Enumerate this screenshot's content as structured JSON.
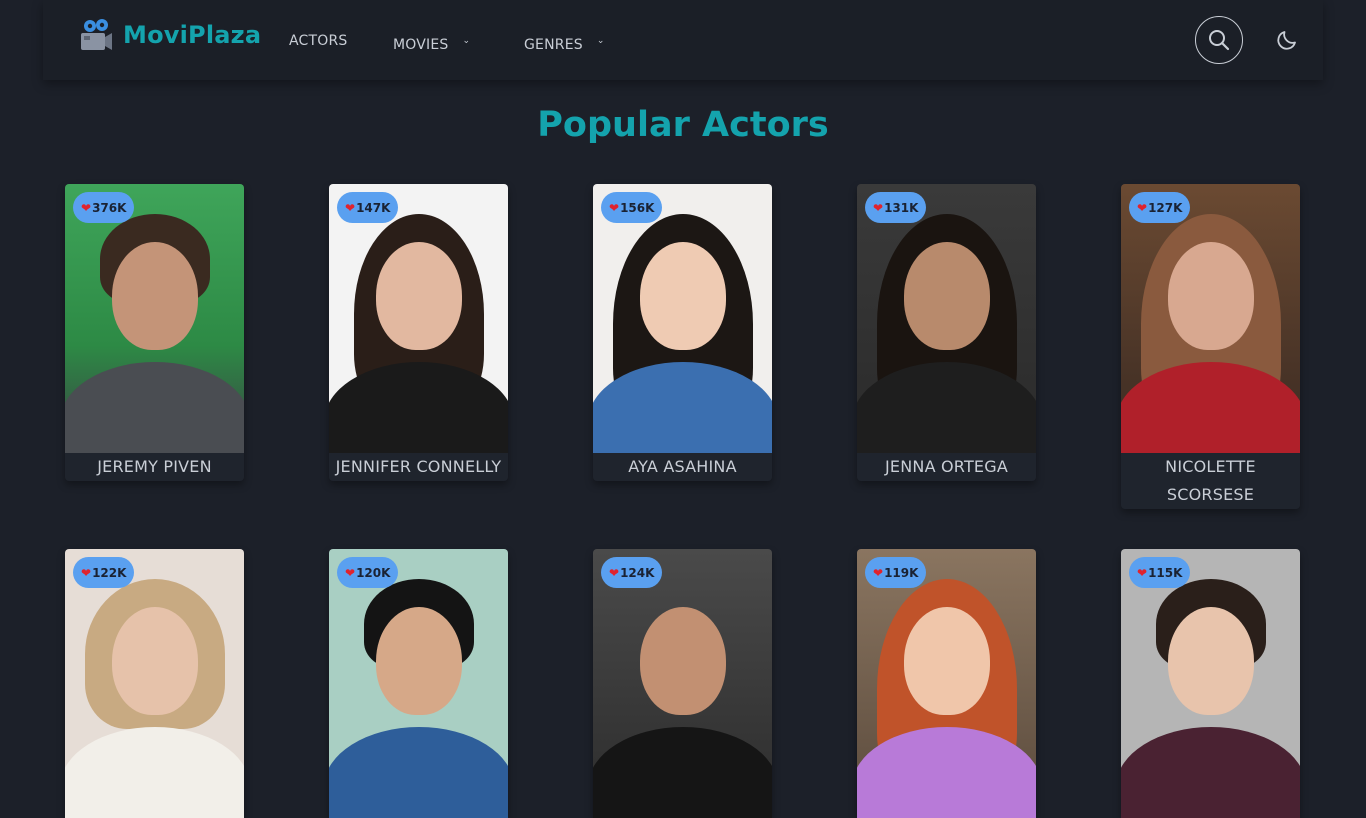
{
  "header": {
    "brand": "MoviPlaza",
    "nav": {
      "actors": "ACTORS",
      "movies": "MOVIES",
      "genres": "GENRES"
    }
  },
  "main": {
    "title": "Popular Actors",
    "actors": [
      {
        "name": "JEREMY PIVEN",
        "likes": "376K"
      },
      {
        "name": "JENNIFER CONNELLY",
        "likes": "147K"
      },
      {
        "name": "AYA ASAHINA",
        "likes": "156K"
      },
      {
        "name": "JENNA ORTEGA",
        "likes": "131K"
      },
      {
        "name": "NICOLETTE SCORSESE",
        "likes": "127K"
      },
      {
        "name": "",
        "likes": "122K"
      },
      {
        "name": "",
        "likes": "120K"
      },
      {
        "name": "",
        "likes": "124K"
      },
      {
        "name": "",
        "likes": "119K"
      },
      {
        "name": "",
        "likes": "115K"
      }
    ]
  },
  "icons": {
    "like": "heart-icon",
    "search": "search-icon",
    "theme": "moon-icon",
    "logo": "film-camera-icon"
  },
  "colors": {
    "accent": "#14a3ad",
    "badge": "#5aa0f0",
    "heart": "#e0232e",
    "background": "#1c2029"
  }
}
